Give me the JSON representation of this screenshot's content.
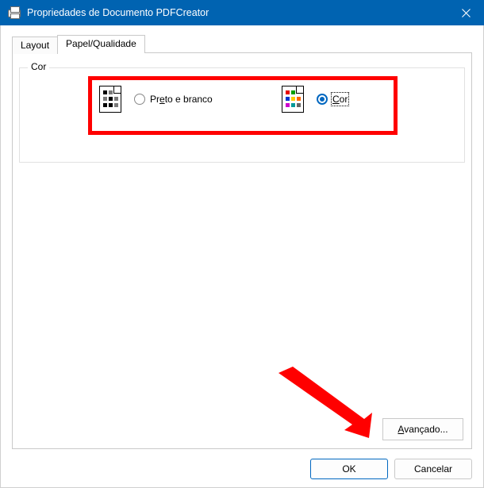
{
  "window": {
    "title": "Propriedades de Documento PDFCreator"
  },
  "tabs": {
    "layout": "Layout",
    "paper_quality": "Papel/Qualidade"
  },
  "group": {
    "legend": "Cor"
  },
  "options": {
    "bw_label_pre": "Pr",
    "bw_label_u": "e",
    "bw_label_post": "to e branco",
    "color_label_u": "C",
    "color_label_post": "or"
  },
  "buttons": {
    "advanced_u": "A",
    "advanced_rest": "vançado...",
    "ok": "OK",
    "cancel": "Cancelar"
  },
  "colors": {
    "accent": "#0067C0",
    "annotation": "#ff0000"
  }
}
